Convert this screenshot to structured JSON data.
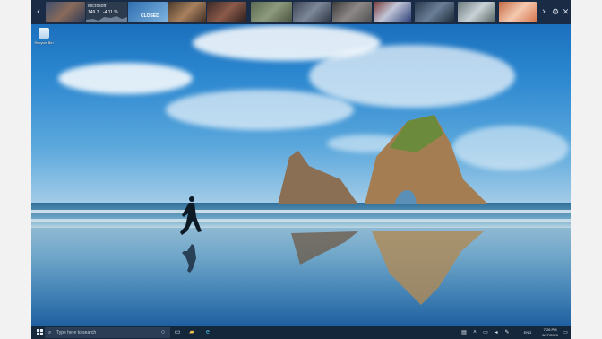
{
  "news_bar": {
    "prev_icon": "chevron-left-icon",
    "next_icon": "chevron-right-icon",
    "settings_icon": "gear-icon",
    "close_icon": "close-icon",
    "ticker": {
      "name": "Microsoft",
      "value": "149.7",
      "change": "-4.11 %"
    },
    "closed_label": "CLOSED"
  },
  "desktop": {
    "recycle_bin_label": "Recycle Bin"
  },
  "taskbar": {
    "start_icon": "windows-start-icon",
    "search_placeholder": "Type here to search",
    "clock_time": "7:26 PM",
    "clock_date": "5/27/2020",
    "language": "ENG"
  }
}
